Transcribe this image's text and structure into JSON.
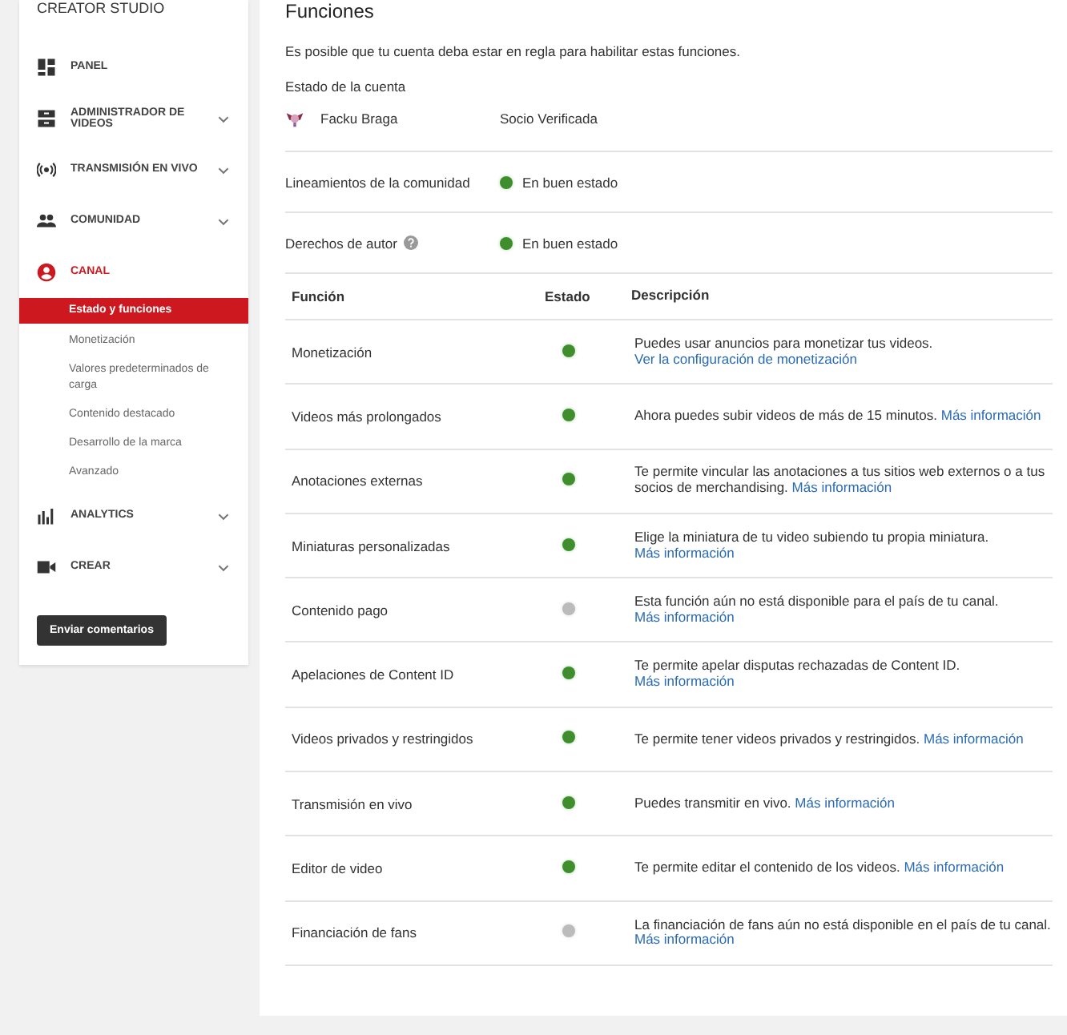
{
  "sidebar": {
    "title": "CREATOR STUDIO",
    "items": [
      {
        "label": "PANEL",
        "kind": "dashboard",
        "expandable": false,
        "selected": false
      },
      {
        "label": "ADMINISTRADOR DE VIDEOS",
        "kind": "video-manager",
        "expandable": true,
        "selected": false
      },
      {
        "label": "TRANSMISIÓN EN VIVO",
        "kind": "broadcast",
        "expandable": true,
        "selected": false
      },
      {
        "label": "COMUNIDAD",
        "kind": "people",
        "expandable": true,
        "selected": false
      },
      {
        "label": "CANAL",
        "kind": "person",
        "expandable": false,
        "selected": true,
        "children": [
          {
            "label": "Estado y funciones",
            "selected": true
          },
          {
            "label": "Monetización",
            "selected": false
          },
          {
            "label": "Valores predeterminados de carga",
            "selected": false
          },
          {
            "label": "Contenido destacado",
            "selected": false
          },
          {
            "label": "Desarrollo de la marca",
            "selected": false
          },
          {
            "label": "Avanzado",
            "selected": false
          }
        ]
      },
      {
        "label": "ANALYTICS",
        "kind": "chart",
        "expandable": true,
        "selected": false
      },
      {
        "label": "CREAR",
        "kind": "camera",
        "expandable": true,
        "selected": false
      }
    ],
    "feedback_button": "Enviar comentarios"
  },
  "main": {
    "title": "Funciones",
    "intro": "Es posible que tu cuenta deba estar en regla para habilitar estas funciones.",
    "account_heading": "Estado de la cuenta",
    "account": {
      "name": "Facku Braga",
      "status": "Socio Verificada"
    },
    "standing": [
      {
        "label": "Lineamientos de la comunidad",
        "help": false,
        "available": true,
        "status": "En buen estado"
      },
      {
        "label": "Derechos de autor",
        "help": true,
        "available": true,
        "status": "En buen estado"
      }
    ],
    "table": {
      "columns": [
        "Función",
        "Estado",
        "Descripción"
      ],
      "rows": [
        {
          "feature": "Monetización",
          "available": true,
          "description": "Puedes usar anuncios para monetizar tus videos.",
          "link": "Ver la configuración de monetización"
        },
        {
          "feature": "Videos más prolongados",
          "available": true,
          "description": "Ahora puedes subir videos de más de 15 minutos.",
          "link": "Más información"
        },
        {
          "feature": "Anotaciones externas",
          "available": true,
          "description": "Te permite vincular las anotaciones a tus sitios web externos o a tus socios de merchandising.",
          "link": "Más información"
        },
        {
          "feature": "Miniaturas personalizadas",
          "available": true,
          "description": "Elige la miniatura de tu video subiendo tu propia miniatura.",
          "link": "Más información"
        },
        {
          "feature": "Contenido pago",
          "available": false,
          "description": "Esta función aún no está disponible para el país de tu canal.",
          "link": "Más información"
        },
        {
          "feature": "Apelaciones de Content ID",
          "available": true,
          "description": "Te permite apelar disputas rechazadas de Content ID.",
          "link": "Más información"
        },
        {
          "feature": "Videos privados y restringidos",
          "available": true,
          "description": "Te permite tener videos privados y restringidos.",
          "link": "Más información"
        },
        {
          "feature": "Transmisión en vivo",
          "available": true,
          "description": "Puedes transmitir en vivo.",
          "link": "Más información"
        },
        {
          "feature": "Editor de video",
          "available": true,
          "description": "Te permite editar el contenido de los videos.",
          "link": "Más información"
        },
        {
          "feature": "Financiación de fans",
          "available": false,
          "description": "La financiación de fans aún no está disponible en el país de tu canal.",
          "link": "Más información"
        }
      ]
    }
  }
}
